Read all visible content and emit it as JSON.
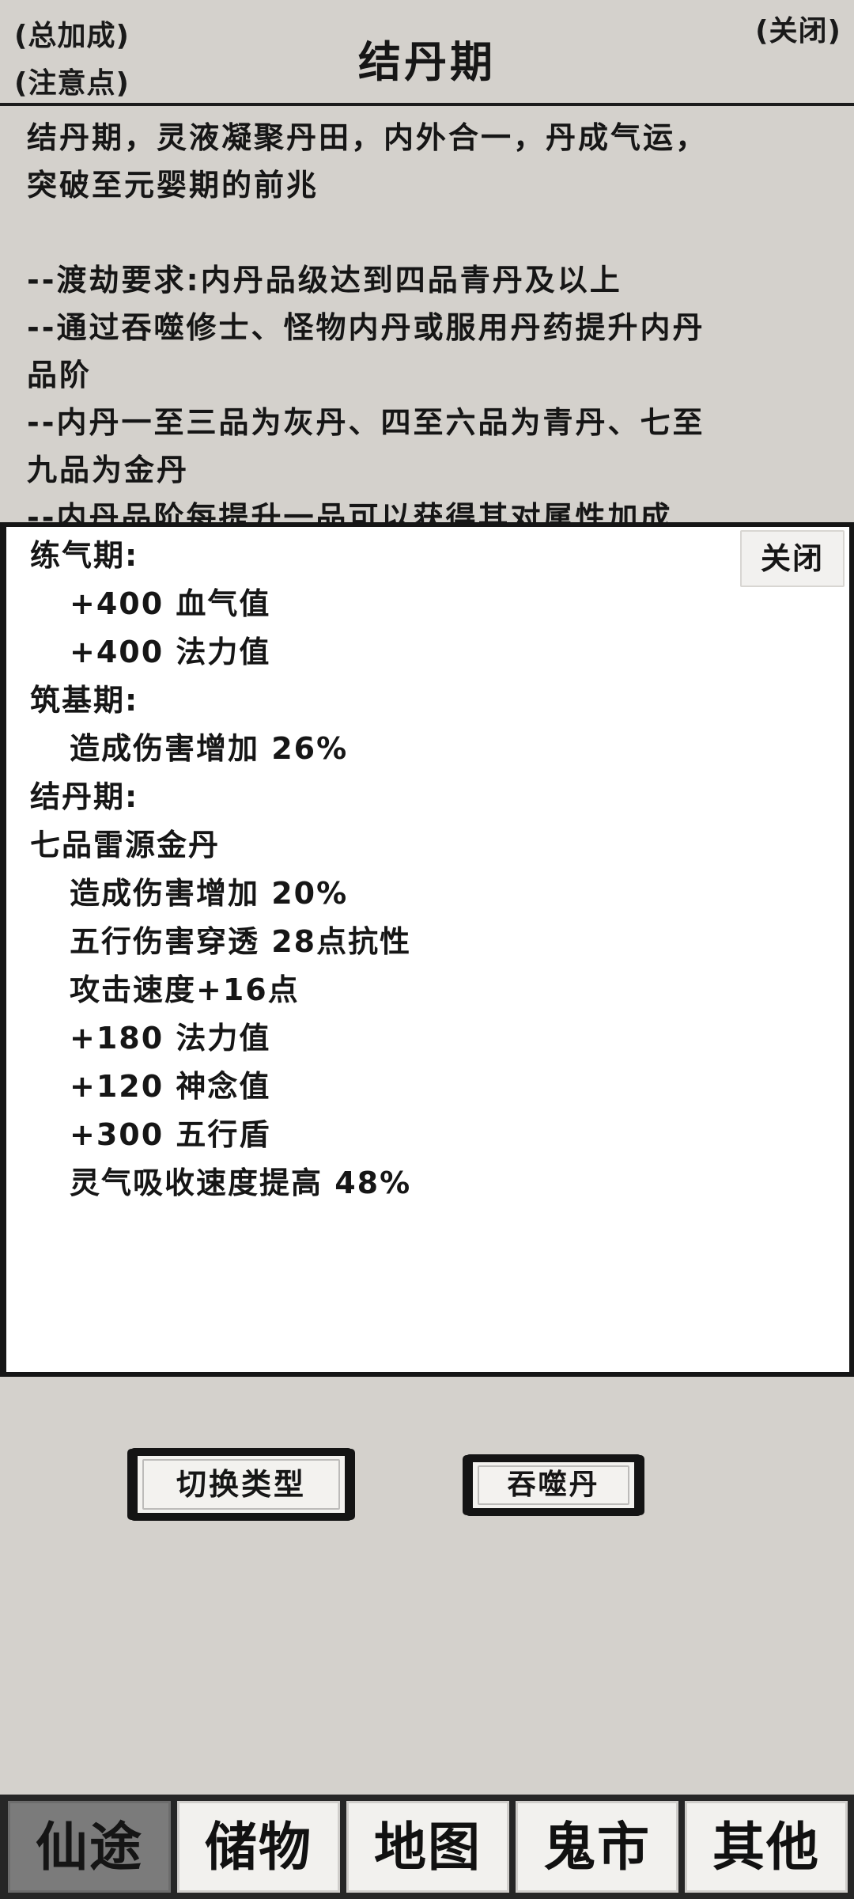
{
  "header": {
    "total_bonus": "(总加成)",
    "notes": "(注意点)",
    "title": "结丹期",
    "close": "(关闭)"
  },
  "description": {
    "lines": [
      "结丹期，灵液凝聚丹田，内外合一，丹成气运，",
      "突破至元婴期的前兆",
      "",
      "--渡劫要求:内丹品级达到四品青丹及以上",
      "--通过吞噬修士、怪物内丹或服用丹药提升内丹",
      "品阶",
      "--内丹一至三品为灰丹、四至六品为青丹、七至",
      "九品为金丹",
      "--内丹品阶每提升一品可以获得其对属性加成"
    ]
  },
  "popup": {
    "close": "关闭",
    "lines": [
      {
        "text": "练气期:",
        "indent": false
      },
      {
        "text": "+400 血气值",
        "indent": true
      },
      {
        "text": "+400 法力值",
        "indent": true
      },
      {
        "text": "筑基期:",
        "indent": false
      },
      {
        "text": "造成伤害增加 26%",
        "indent": true
      },
      {
        "text": "结丹期:",
        "indent": false
      },
      {
        "text": "七品雷源金丹",
        "indent": false
      },
      {
        "text": "造成伤害增加 20%",
        "indent": true
      },
      {
        "text": "五行伤害穿透 28点抗性",
        "indent": true
      },
      {
        "text": "攻击速度+16点",
        "indent": true
      },
      {
        "text": "+180 法力值",
        "indent": true
      },
      {
        "text": "+120 神念值",
        "indent": true
      },
      {
        "text": "+300 五行盾",
        "indent": true
      },
      {
        "text": "灵气吸收速度提高 48%",
        "indent": true
      }
    ]
  },
  "actions": {
    "switch_type": "切换类型",
    "devour_pill": "吞噬丹"
  },
  "nav": {
    "tabs": [
      "仙途",
      "储物",
      "地图",
      "鬼市",
      "其他"
    ],
    "active": 0
  }
}
